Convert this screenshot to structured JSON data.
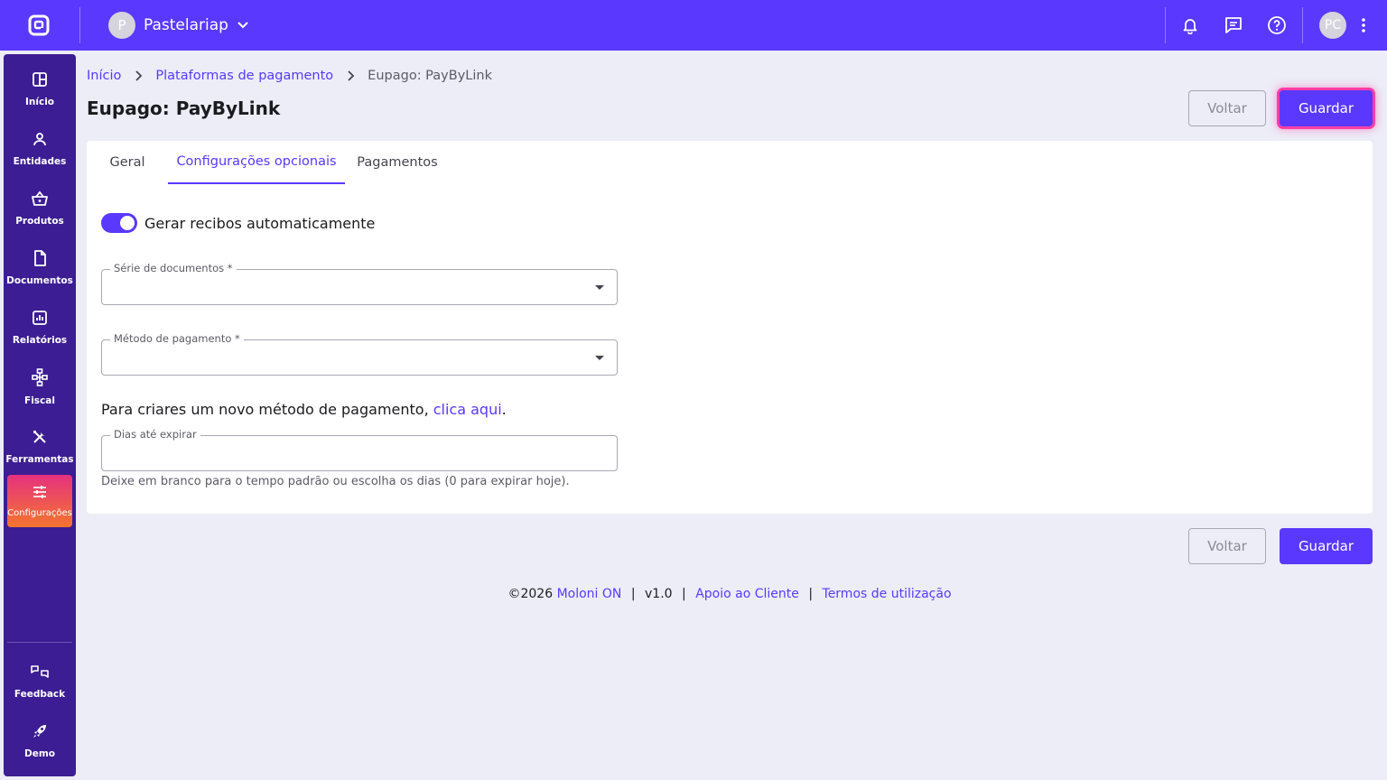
{
  "company": {
    "initial": "P",
    "name": "Pastelariap"
  },
  "user": {
    "initials": "PC"
  },
  "sidebar": {
    "items": [
      {
        "label": "Início",
        "icon": "dashboard-icon"
      },
      {
        "label": "Entidades",
        "icon": "user-icon"
      },
      {
        "label": "Produtos",
        "icon": "basket-icon"
      },
      {
        "label": "Documentos",
        "icon": "document-icon"
      },
      {
        "label": "Relatórios",
        "icon": "chart-icon"
      },
      {
        "label": "Fiscal",
        "icon": "network-icon"
      },
      {
        "label": "Ferramentas",
        "icon": "tools-icon"
      },
      {
        "label": "Configurações",
        "icon": "sliders-icon",
        "active": true
      }
    ],
    "bottom": [
      {
        "label": "Feedback",
        "icon": "feedback-icon"
      },
      {
        "label": "Demo",
        "icon": "rocket-icon"
      }
    ]
  },
  "breadcrumb": {
    "home": "Início",
    "parent": "Plataformas de pagamento",
    "current": "Eupago: PayByLink"
  },
  "page": {
    "title": "Eupago: PayByLink",
    "back_label": "Voltar",
    "save_label": "Guardar"
  },
  "tabs": [
    {
      "label": "Geral"
    },
    {
      "label": "Configurações opcionais",
      "active": true
    },
    {
      "label": "Pagamentos"
    }
  ],
  "form": {
    "auto_receipts": {
      "label": "Gerar recibos automaticamente",
      "on": true
    },
    "document_series": {
      "label": "Série de documentos *",
      "value": ""
    },
    "payment_method": {
      "label": "Método de pagamento *",
      "value": ""
    },
    "info_prefix": "Para criares um novo método de pagamento, ",
    "info_link": "clica aqui",
    "info_suffix": ".",
    "days_to_expire": {
      "label": "Dias até expirar",
      "value": ""
    },
    "days_hint": "Deixe em branco para o tempo padrão ou escolha os dias (0 para expirar hoje)."
  },
  "footer": {
    "copyright": "©2026",
    "brand": "Moloni ON",
    "version": "v1.0",
    "support": "Apoio ao Cliente",
    "terms": "Termos de utilização",
    "separator": "|"
  },
  "colors": {
    "primary": "#5a38fd",
    "sidebar": "#3c1d93",
    "active_gradient_start": "#e5317f",
    "active_gradient_end": "#f5752e",
    "background": "#ecedf7",
    "focus_ring": "#ff3ea5"
  }
}
